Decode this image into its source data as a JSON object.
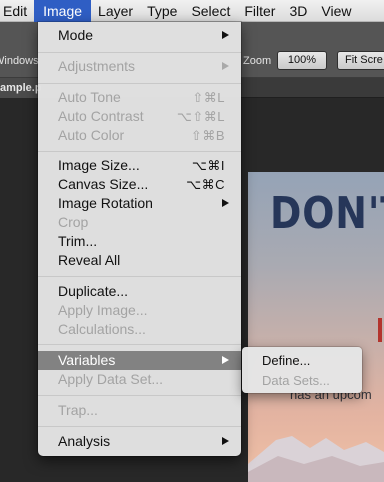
{
  "menubar": {
    "items": [
      "Edit",
      "Image",
      "Layer",
      "Type",
      "Select",
      "Filter",
      "3D",
      "View"
    ]
  },
  "options_bar": {
    "windows_label": "Windows",
    "zoom_label": "Zoom",
    "zoom_value": "100%",
    "fit_screen_label": "Fit Scre"
  },
  "document_tab": {
    "label": "ample.p"
  },
  "image_menu": {
    "mode": "Mode",
    "adjustments": "Adjustments",
    "auto_tone": "Auto Tone",
    "auto_tone_sc": "⇧⌘L",
    "auto_contrast": "Auto Contrast",
    "auto_contrast_sc": "⌥⇧⌘L",
    "auto_color": "Auto Color",
    "auto_color_sc": "⇧⌘B",
    "image_size": "Image Size...",
    "image_size_sc": "⌥⌘I",
    "canvas_size": "Canvas Size...",
    "canvas_size_sc": "⌥⌘C",
    "image_rotation": "Image Rotation",
    "crop": "Crop",
    "trim": "Trim...",
    "reveal_all": "Reveal All",
    "duplicate": "Duplicate...",
    "apply_image": "Apply Image...",
    "calculations": "Calculations...",
    "variables": "Variables",
    "apply_data_set": "Apply Data Set...",
    "trap": "Trap...",
    "analysis": "Analysis"
  },
  "variables_submenu": {
    "define": "Define...",
    "data_sets": "Data Sets..."
  },
  "document": {
    "headline": "DON'T",
    "subtext": "has an upcom"
  },
  "colors": {
    "menu_highlight": "#2f5ec4",
    "item_highlight": "#828282",
    "headline": "#263659"
  }
}
